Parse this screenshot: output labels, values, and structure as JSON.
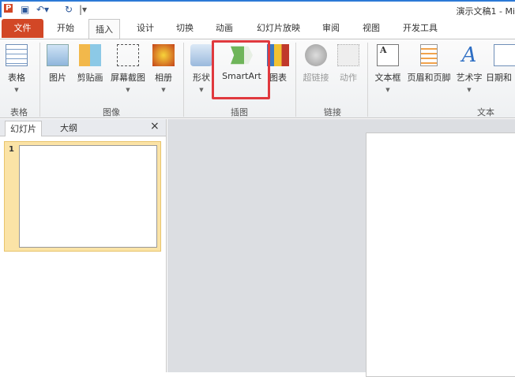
{
  "titlebar": {
    "title": "演示文稿1 - Mi",
    "app_icon": "P"
  },
  "tabs": {
    "file": "文件",
    "items": [
      "开始",
      "插入",
      "设计",
      "切换",
      "动画",
      "幻灯片放映",
      "审阅",
      "视图",
      "开发工具"
    ]
  },
  "ribbon": {
    "buttons": [
      "表格",
      "图片",
      "剪贴画",
      "屏幕截图",
      "相册",
      "形状",
      "SmartArt",
      "图表",
      "超链接",
      "动作",
      "文本框",
      "页眉和页脚",
      "艺术字",
      "日期和"
    ],
    "groups": [
      "表格",
      "图像",
      "插图",
      "链接",
      "文本"
    ]
  },
  "pane": {
    "tabs": [
      "幻灯片",
      "大纲"
    ],
    "close": "×",
    "slide_number": "1"
  },
  "colors": {
    "file_tab": "#d24726",
    "highlight": "#e0393e"
  }
}
